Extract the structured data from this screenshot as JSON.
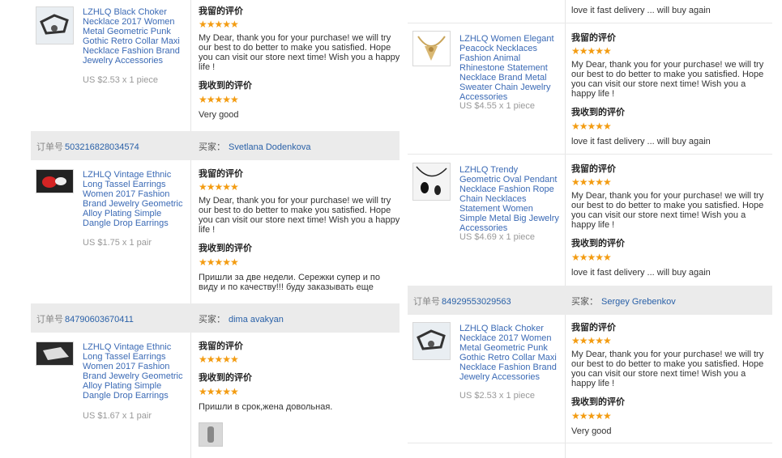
{
  "labels": {
    "order_no": "订单号",
    "buyer": "买家：",
    "seller_reply": "我留的评价",
    "received": "我收到的评价",
    "stars": "★★★★★"
  },
  "left": {
    "block1": {
      "product": "LZHLQ Black Choker Necklace 2017 Women Metal Geometric Punk Gothic Retro Collar Maxi Necklace Fashion Brand Jewelry Accessories",
      "price": "US $2.53 x 1 piece",
      "seller_text": "My Dear, thank you for your purchase! we will try our best to do better to make you satisfied. Hope you can visit our store next time! Wish you a happy life !",
      "received_text": "Very good"
    },
    "order2": {
      "number": "503216828034574",
      "buyer_name": "Svetlana Dodenkova"
    },
    "block2": {
      "product": "LZHLQ Vintage Ethnic Long Tassel Earrings Women 2017 Fashion Brand Jewelry Geometric Alloy Plating Simple Dangle Drop Earrings",
      "price": "US $1.75 x 1 pair",
      "seller_text": "My Dear, thank you for your purchase! we will try our best to do better to make you satisfied. Hope you can visit our store next time! Wish you a happy life !",
      "received_text": "Пришли за две недели. Сережки супер и по виду и по качеству!!! буду заказывать еще"
    },
    "order3": {
      "number": "84790603670411",
      "buyer_name": "dima avakyan"
    },
    "block3": {
      "product": "LZHLQ Vintage Ethnic Long Tassel Earrings Women 2017 Fashion Brand Jewelry Geometric Alloy Plating Simple Dangle Drop Earrings",
      "price": "US $1.67 x 1 pair",
      "received_text": "Пришли в срок,жена довольная."
    }
  },
  "right": {
    "top_text": "love it fast delivery ... will buy again",
    "block1": {
      "product": "LZHLQ Women Elegant Peacock Necklaces Fashion Animal Rhinestone Statement Necklace Brand Metal Sweater Chain Jewelry Accessories",
      "price": "US $4.55 x 1 piece",
      "seller_text": "My Dear, thank you for your purchase! we will try our best to do better to make you satisfied. Hope you can visit our store next time! Wish you a happy life !",
      "received_text": "love it fast delivery ... will buy again"
    },
    "block2": {
      "product": "LZHLQ Trendy Geometric Oval Pendant Necklace Fashion Rope Chain Necklaces Statement Women Simple Metal Big Jewelry Accessories",
      "price": "US $4.69 x 1 piece",
      "seller_text": "My Dear, thank you for your purchase! we will try our best to do better to make you satisfied. Hope you can visit our store next time! Wish you a happy life !",
      "received_text": "love it fast delivery ... will buy again"
    },
    "order3": {
      "number": "84929553029563",
      "buyer_name": "Sergey Grebenkov"
    },
    "block3": {
      "product": "LZHLQ Black Choker Necklace 2017 Women Metal Geometric Punk Gothic Retro Collar Maxi Necklace Fashion Brand Jewelry Accessories",
      "price": "US $2.53 x 1 piece",
      "seller_text": "My Dear, thank you for your purchase! we will try our best to do better to make you satisfied. Hope you can visit our store next time! Wish you a happy life !",
      "received_text": "Very good"
    }
  },
  "colors": {
    "link": "#2a61a8",
    "star": "#f39c12",
    "bar": "#ebebeb"
  },
  "icons": {
    "rating": "star-icon"
  }
}
